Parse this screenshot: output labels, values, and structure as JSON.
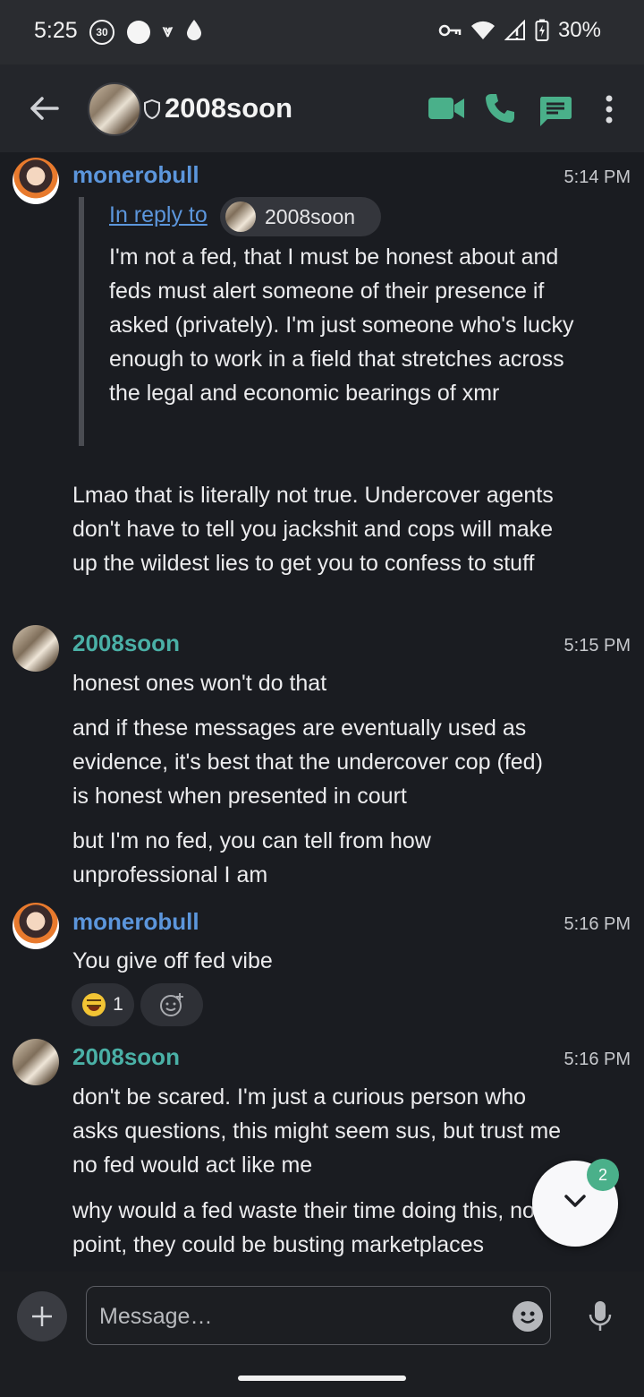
{
  "status_bar": {
    "time": "5:25",
    "badge": "30",
    "battery": "30%"
  },
  "header": {
    "title": "2008soon",
    "icons": [
      "back-arrow-icon",
      "shield-icon",
      "video-call-icon",
      "phone-icon",
      "threads-icon",
      "more-vert-icon"
    ],
    "accent": "#4ab08a"
  },
  "messages": [
    {
      "sender": "monerobull",
      "time": "5:14 PM",
      "reply": {
        "link": "In reply to",
        "to": "2008soon",
        "text": "I'm not a fed, that I must be honest about and feds must alert someone of their presence if asked (privately). I'm just someone who's lucky enough to work in a field that stretches across the legal and economic bearings of xmr"
      },
      "body": [
        "Lmao that is literally not true. Undercover agents don't have to tell you jackshit and cops will make up the wildest lies to get you to confess to stuff"
      ]
    },
    {
      "sender": "2008soon",
      "time": "5:15 PM",
      "body": [
        "honest ones won't do that",
        "and if these messages are eventually used as evidence, it's best that the undercover cop (fed) is honest when presented in court",
        "but I'm no fed, you can tell from how unprofessional I am"
      ]
    },
    {
      "sender": "monerobull",
      "time": "5:16 PM",
      "body": [
        "You give off fed vibe"
      ],
      "reaction": {
        "emoji": "joy-emoji",
        "count": "1"
      }
    },
    {
      "sender": "2008soon",
      "time": "5:16 PM",
      "body": [
        "don't be scared. I'm just a curious person who asks questions, this might seem sus, but trust me no fed would act like me",
        "why would a fed waste their time doing this, no point, they could be busting marketplaces"
      ]
    }
  ],
  "fab": {
    "badge": "2"
  },
  "composer": {
    "placeholder": "Message…"
  }
}
